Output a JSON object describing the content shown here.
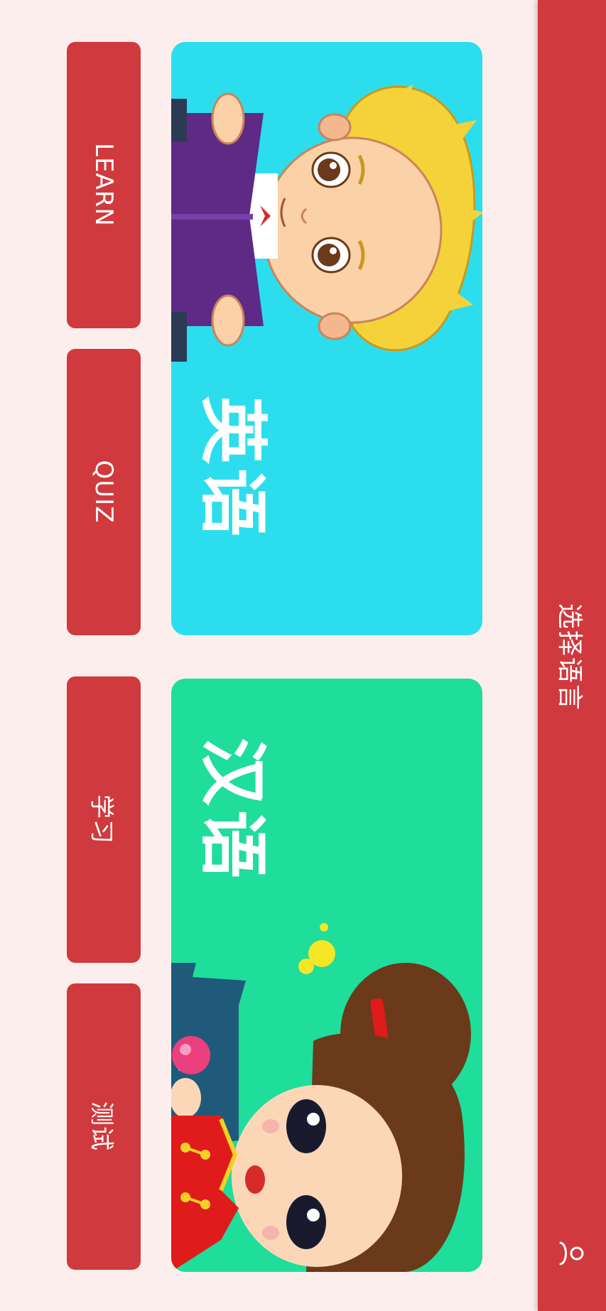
{
  "header": {
    "title": "选择语言",
    "profile_icon": "person-icon",
    "background_color": "#d0393d"
  },
  "languages": [
    {
      "name": "英语",
      "card_color": "#2cdeed",
      "illustration": "boy-reading-book-illustration",
      "buttons": [
        {
          "label": "LEARN"
        },
        {
          "label": "QUIZ"
        }
      ]
    },
    {
      "name": "汉语",
      "card_color": "#1fdd9b",
      "illustration": "girl-with-lollipop-illustration",
      "buttons": [
        {
          "label": "学习"
        },
        {
          "label": "测试"
        }
      ]
    }
  ],
  "colors": {
    "page_background": "#fdeeee",
    "button_background": "#d0393d",
    "text": "#ffffff"
  }
}
